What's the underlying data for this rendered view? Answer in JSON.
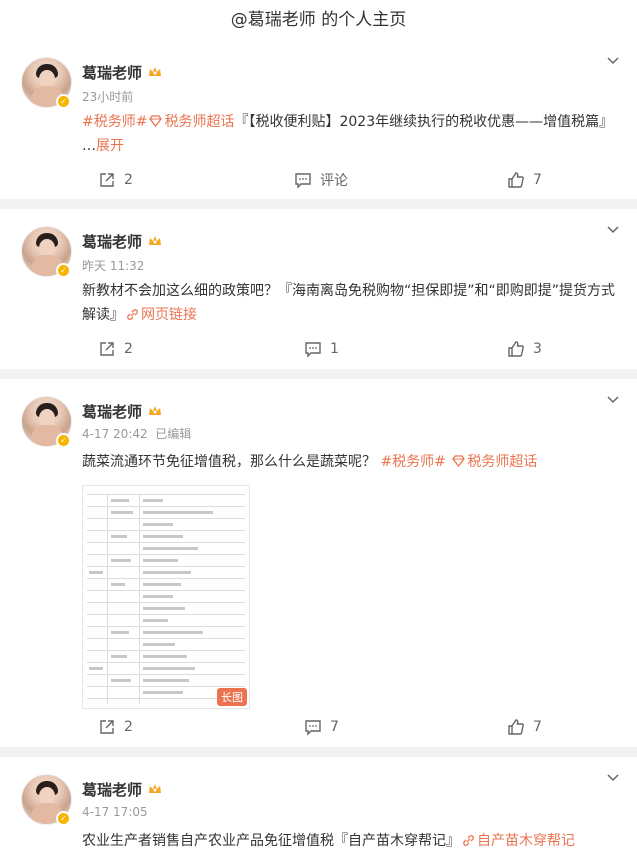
{
  "page": {
    "title": "@葛瑞老师 的个人主页"
  },
  "posts": [
    {
      "author": "葛瑞老师",
      "time": "23小时前",
      "edited": "",
      "tag1": "#税务师#",
      "tag2": "税务师超话",
      "text": "『【税收便利贴】2023年继续执行的税收优惠——增值税篇』 …",
      "expand": "展开",
      "share": "2",
      "comment": "评论",
      "like": "7"
    },
    {
      "author": "葛瑞老师",
      "time": "昨天 11:32",
      "text": "新教材不会加这么细的政策吧？『海南离岛免税购物“担保即提”和“即购即提”提货方式解读』",
      "link": "网页链接",
      "share": "2",
      "comment": "1",
      "like": "3"
    },
    {
      "author": "葛瑞老师",
      "time": "4-17 20:42",
      "edited": "已编辑",
      "text": "蔬菜流通环节免征增值税，那么什么是蔬菜呢？",
      "tag1": "#税务师#",
      "tag2": "税务师超话",
      "image_tag": "长图",
      "share": "2",
      "comment": "7",
      "like": "7"
    },
    {
      "author": "葛瑞老师",
      "time": "4-17 17:05",
      "text": "农业生产者销售自产农业产品免征增值税『自产苗木穿帮记』",
      "link": "自产苗木穿帮记"
    }
  ],
  "colors": {
    "accent": "#eb7350",
    "verified": "#f7b500"
  }
}
